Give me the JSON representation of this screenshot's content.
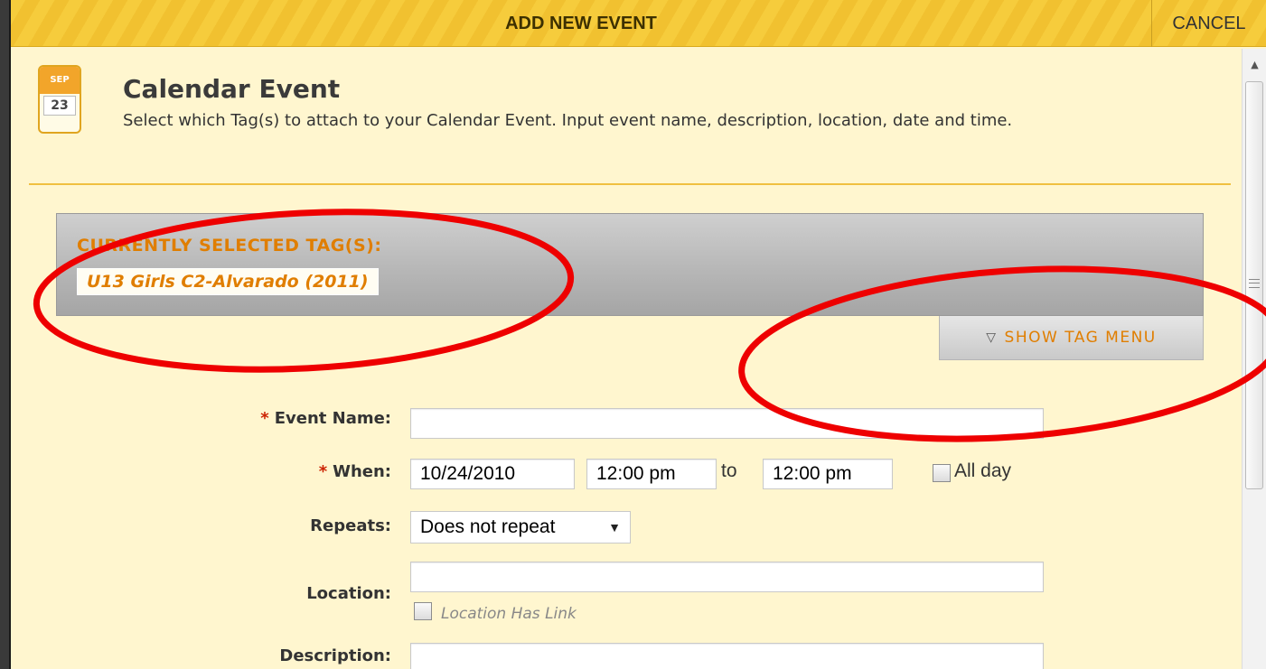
{
  "header": {
    "title": "ADD NEW EVENT",
    "cancel_label": "CANCEL"
  },
  "section": {
    "icon_month": "SEP",
    "icon_day": "23",
    "title": "Calendar Event",
    "description": "Select which Tag(s) to attach to your Calendar Event. Input event name, description, location, date and time."
  },
  "tags": {
    "label": "CURRENTLY SELECTED TAG(S):",
    "selected": "U13 Girls C2-Alvarado (2011)",
    "show_menu_label": "SHOW TAG MENU"
  },
  "form": {
    "required_mark": "*",
    "event_name": {
      "label": "Event Name:",
      "value": ""
    },
    "when": {
      "label": "When:",
      "date": "10/24/2010",
      "start_time": "12:00 pm",
      "to_label": "to",
      "end_time": "12:00 pm",
      "all_day_label": "All day"
    },
    "repeats": {
      "label": "Repeats:",
      "value": "Does not repeat"
    },
    "location": {
      "label": "Location:",
      "value": "",
      "has_link_label": "Location Has Link"
    },
    "description": {
      "label": "Description:",
      "value": ""
    }
  },
  "colors": {
    "accent_orange": "#e07e00",
    "header_yellow": "#f6cc3c",
    "panel_bg": "#fff6cf",
    "annotation_red": "#ee0000"
  }
}
